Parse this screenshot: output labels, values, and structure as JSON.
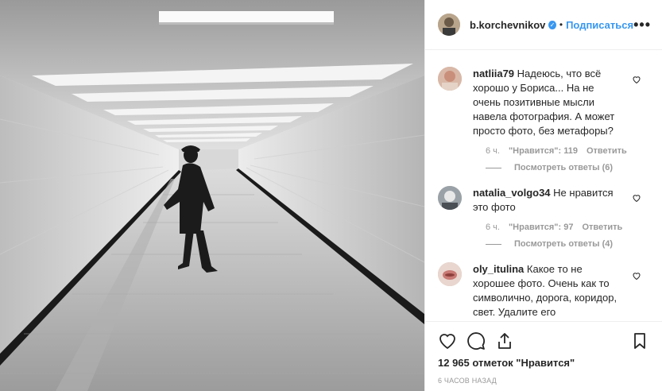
{
  "post": {
    "username": "b.korchevnikov",
    "verified_mark": "✓",
    "separator": "•",
    "follow_label": "Подписаться",
    "more_label": "•••"
  },
  "comments": [
    {
      "username": "natliia79",
      "text": "Надеюсь, что всё хорошо у Бориса... На не очень позитивные мысли навела фотография. А может просто фото, без метафоры?",
      "time": "6 ч.",
      "likes": "\"Нравится\": 119",
      "reply": "Ответить",
      "view_replies": "Посмотреть ответы (6)"
    },
    {
      "username": "natalia_volgo34",
      "text": "Не нравится это фото",
      "time": "6 ч.",
      "likes": "\"Нравится\": 97",
      "reply": "Ответить",
      "view_replies": "Посмотреть ответы (4)"
    },
    {
      "username": "oly_itulina",
      "text": "Какое то не хорошее фото. Очень как то символично, дорога, коридор, свет. Удалите его"
    }
  ],
  "footer": {
    "likes_count": "12 965 отметок \"Нравится\"",
    "time_ago": "6 часов назад"
  },
  "icons": {
    "heart": "heart-icon",
    "comment": "comment-icon",
    "share": "share-icon",
    "bookmark": "bookmark-icon",
    "more": "more-icon"
  },
  "colors": {
    "link_blue": "#3897f0",
    "muted": "#999999",
    "border": "#efefef"
  }
}
